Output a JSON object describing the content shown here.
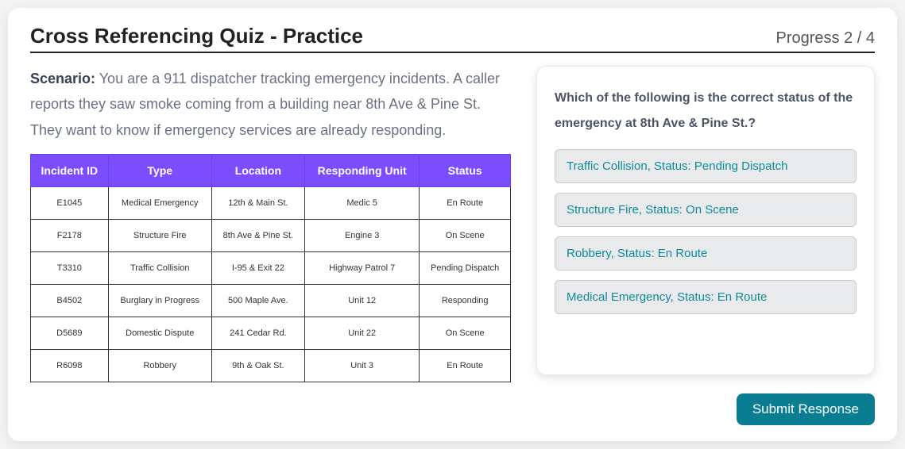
{
  "header": {
    "title": "Cross Referencing Quiz - Practice",
    "progress": "Progress 2 / 4"
  },
  "scenario": {
    "label": "Scenario:",
    "text": " You are a 911 dispatcher tracking emergency incidents. A caller reports they saw smoke coming from a building near 8th Ave & Pine St. They want to know if emergency services are already responding."
  },
  "table": {
    "headers": [
      "Incident ID",
      "Type",
      "Location",
      "Responding Unit",
      "Status"
    ],
    "rows": [
      [
        "E1045",
        "Medical Emergency",
        "12th & Main St.",
        "Medic 5",
        "En Route"
      ],
      [
        "F2178",
        "Structure Fire",
        "8th Ave & Pine St.",
        "Engine 3",
        "On Scene"
      ],
      [
        "T3310",
        "Traffic Collision",
        "I-95 & Exit 22",
        "Highway Patrol 7",
        "Pending Dispatch"
      ],
      [
        "B4502",
        "Burglary in Progress",
        "500 Maple Ave.",
        "Unit 12",
        "Responding"
      ],
      [
        "D5689",
        "Domestic Dispute",
        "241 Cedar Rd.",
        "Unit 22",
        "On Scene"
      ],
      [
        "R6098",
        "Robbery",
        "9th & Oak St.",
        "Unit 3",
        "En Route"
      ]
    ]
  },
  "question": "Which of the following is the correct status of the emergency at 8th Ave & Pine St.?",
  "options": [
    "Traffic Collision, Status: Pending Dispatch",
    "Structure Fire, Status: On Scene",
    "Robbery, Status: En Route",
    "Medical Emergency, Status: En Route"
  ],
  "submit_label": "Submit Response"
}
